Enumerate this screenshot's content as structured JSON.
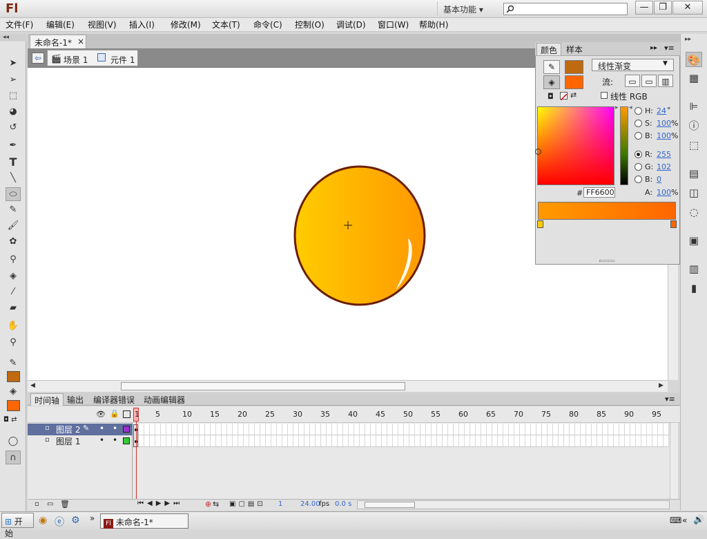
{
  "app": {
    "logo": "Fl",
    "workspace": "基本功能 ▾"
  },
  "window_buttons": {
    "minimize": "—",
    "restore": "❐",
    "close": "✕"
  },
  "menu": [
    "文件(F)",
    "编辑(E)",
    "视图(V)",
    "插入(I)",
    "修改(M)",
    "文本(T)",
    "命令(C)",
    "控制(O)",
    "调试(D)",
    "窗口(W)",
    "帮助(H)"
  ],
  "document": {
    "tab_title": "未命名-1*",
    "tab_close": "×"
  },
  "breadcrumb": {
    "scene": "场景 1",
    "symbol": "元件 1"
  },
  "color_panel": {
    "tabs": [
      "颜色",
      "样本"
    ],
    "fill_type": "线性渐变",
    "flow_label": "流:",
    "linear_rgb_label": "线性 RGB",
    "stroke_color": "#c06a10",
    "fill_color": "#ff6600",
    "hsb": [
      {
        "label": "H:",
        "value": "24",
        "unit": "°"
      },
      {
        "label": "S:",
        "value": "100",
        "unit": "%"
      },
      {
        "label": "B:",
        "value": "100",
        "unit": "%"
      }
    ],
    "rgb": [
      {
        "label": "R:",
        "value": "255"
      },
      {
        "label": "G:",
        "value": "102"
      },
      {
        "label": "B:",
        "value": "0"
      }
    ],
    "hex_label": "#",
    "hex": "FF6600",
    "alpha_label": "A:",
    "alpha": "100",
    "alpha_unit": "%",
    "gradient_start": "#ffcc00",
    "gradient_end": "#ff6600"
  },
  "timeline": {
    "tabs": [
      "时间轴",
      "输出",
      "编译器错误",
      "动画编辑器"
    ],
    "frame_numbers": [
      "1",
      "5",
      "10",
      "15",
      "20",
      "25",
      "30",
      "35",
      "40",
      "45",
      "50",
      "55",
      "60",
      "65",
      "70",
      "75",
      "80",
      "85",
      "90",
      "95"
    ],
    "layers": [
      {
        "name": "图层 2",
        "selected": true,
        "color": "#9933cc"
      },
      {
        "name": "图层 1",
        "selected": false,
        "color": "#33cc33"
      }
    ],
    "current_frame": "1",
    "fps": "24.00",
    "fps_unit": "fps",
    "time": "0.0 s"
  },
  "taskbar": {
    "start": "开始",
    "task": "未命名-1*",
    "more": "»"
  }
}
